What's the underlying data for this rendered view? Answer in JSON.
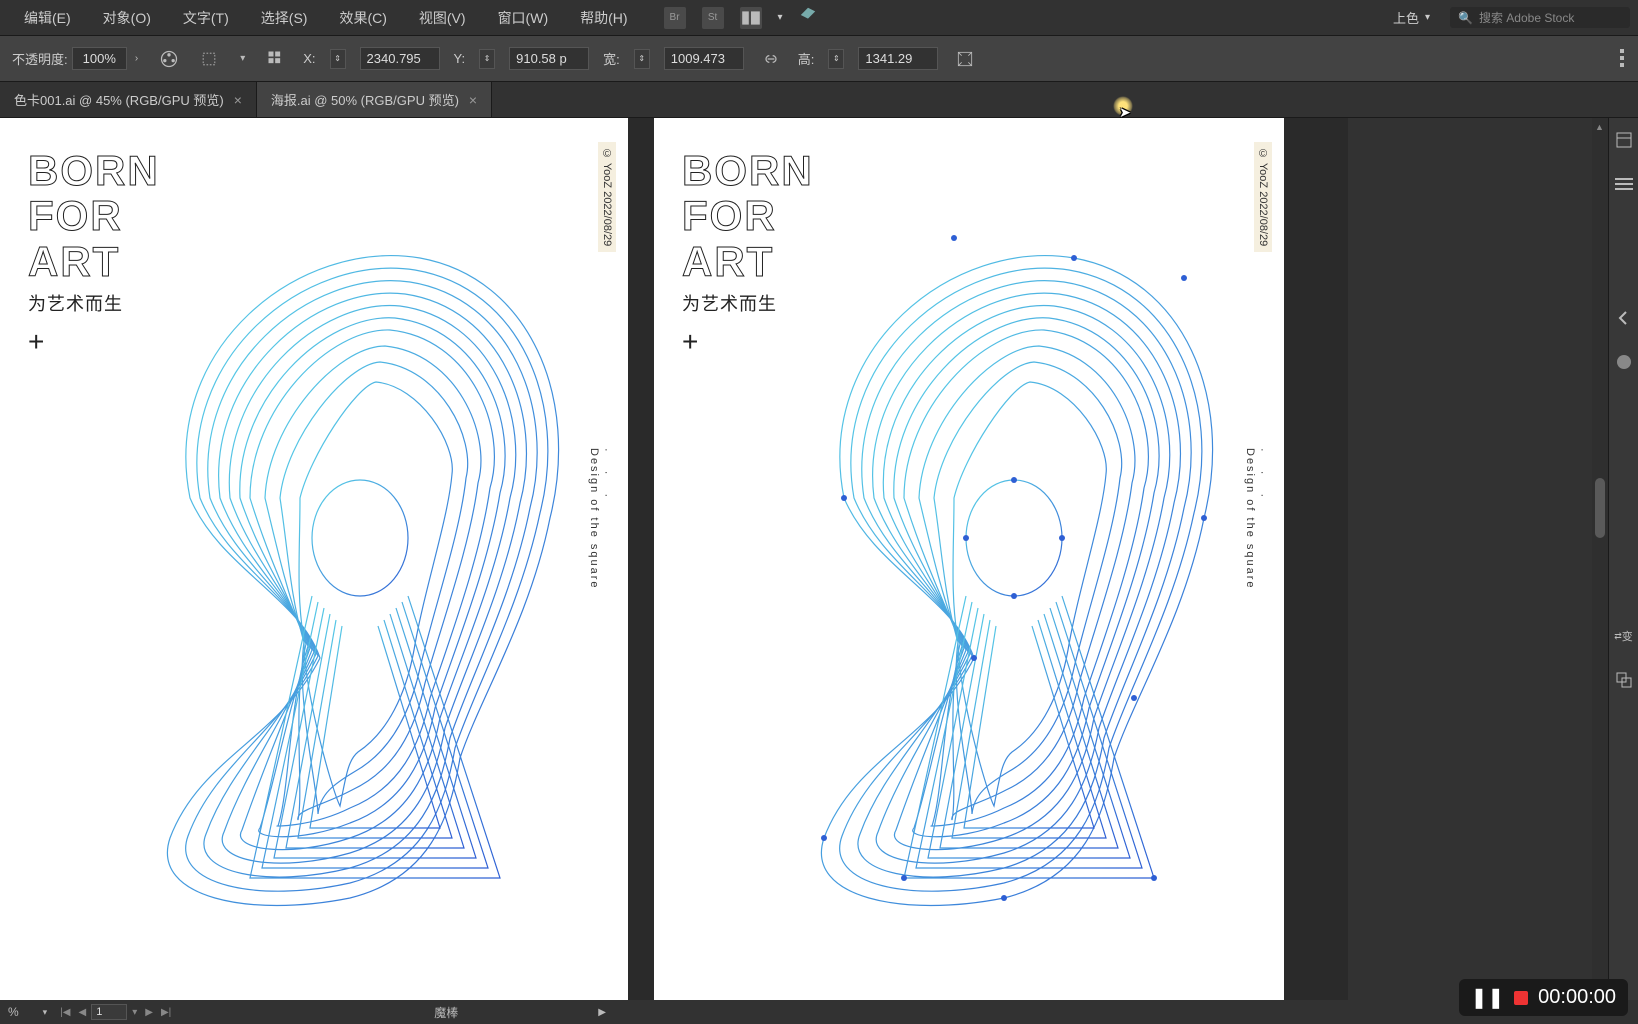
{
  "menu": {
    "items": [
      "编辑(E)",
      "对象(O)",
      "文字(T)",
      "选择(S)",
      "效果(C)",
      "视图(V)",
      "窗口(W)",
      "帮助(H)"
    ],
    "workspace_label": "上色",
    "search_placeholder": "搜索 Adobe Stock",
    "icon_br": "Br",
    "icon_st": "St"
  },
  "options": {
    "opacity_label": "不透明度:",
    "opacity_value": "100%",
    "x_label": "X:",
    "x_value": "2340.795",
    "y_label": "Y:",
    "y_value": "910.58 p",
    "w_label": "宽:",
    "w_value": "1009.473",
    "h_label": "高:",
    "h_value": "1341.29"
  },
  "tabs": [
    {
      "label": "色卡001.ai @ 45% (RGB/GPU 预览)",
      "active": false
    },
    {
      "label": "海报.ai @ 50% (RGB/GPU 预览)",
      "active": true
    }
  ],
  "poster": {
    "line1": "BORN",
    "line2": "FOR",
    "line3": "ART",
    "sub": "为艺术而生",
    "plus": "+",
    "badge": "© YooZ   2022/08/29",
    "caption_dots": "· · ·",
    "caption": "Design of the square"
  },
  "status": {
    "zoom": "%",
    "artboard_num": "1",
    "tool": "魔棒"
  },
  "recorder": {
    "time": "00:00:00"
  },
  "right_panel": {
    "transform_label": "变"
  }
}
